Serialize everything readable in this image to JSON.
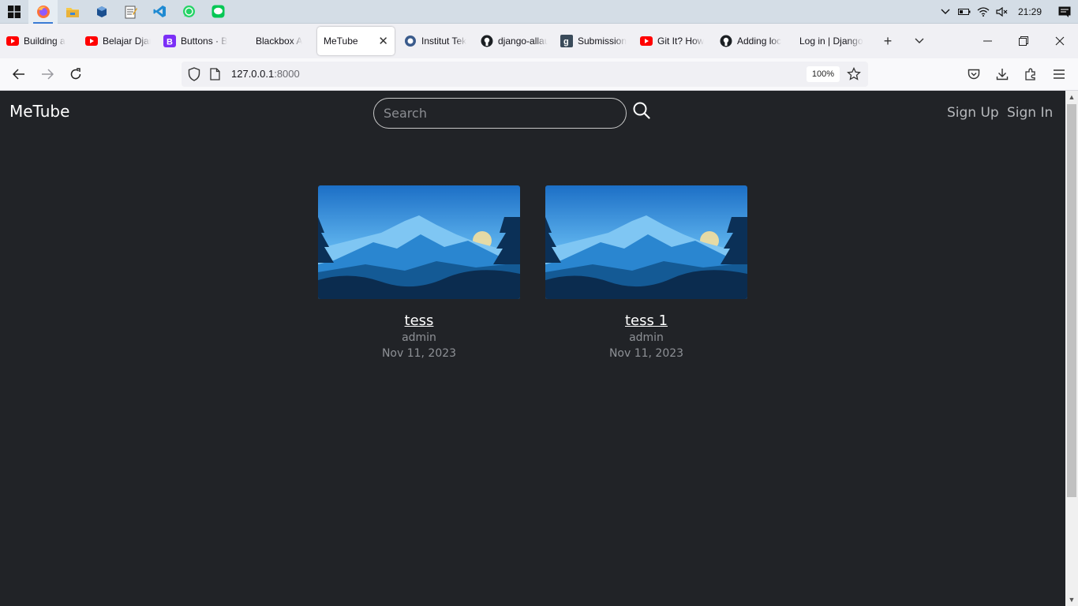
{
  "taskbar": {
    "apps": [
      {
        "name": "firefox-icon",
        "active": true
      },
      {
        "name": "file-explorer-icon"
      },
      {
        "name": "virtualbox-icon"
      },
      {
        "name": "notepad-icon"
      },
      {
        "name": "vscode-icon"
      },
      {
        "name": "whatsapp-icon"
      },
      {
        "name": "line-icon"
      }
    ],
    "clock": "21:29"
  },
  "tabs": [
    {
      "title": "Building a",
      "icon": "youtube-icon"
    },
    {
      "title": "Belajar Djan",
      "icon": "youtube-icon"
    },
    {
      "title": "Buttons · B",
      "icon": "bootstrap-icon"
    },
    {
      "title": "Blackbox A",
      "icon": "none"
    },
    {
      "title": "MeTube",
      "icon": "none",
      "active": true
    },
    {
      "title": "Institut Tek",
      "icon": "institut-icon"
    },
    {
      "title": "django-allau",
      "icon": "github-icon"
    },
    {
      "title": "Submission",
      "icon": "gradescope-icon"
    },
    {
      "title": "Git It? How",
      "icon": "youtube-icon"
    },
    {
      "title": "Adding loc",
      "icon": "github-icon"
    },
    {
      "title": "Log in | Django",
      "icon": "none"
    }
  ],
  "urlbar": {
    "host": "127.0.0.1",
    "port": ":8000",
    "zoom": "100%"
  },
  "site": {
    "brand": "MeTube",
    "search_placeholder": "Search",
    "signup": "Sign Up",
    "signin": "Sign In"
  },
  "videos": [
    {
      "title": "tess",
      "author": "admin",
      "date": "Nov 11, 2023"
    },
    {
      "title": "tess 1",
      "author": "admin",
      "date": "Nov 11, 2023"
    }
  ]
}
